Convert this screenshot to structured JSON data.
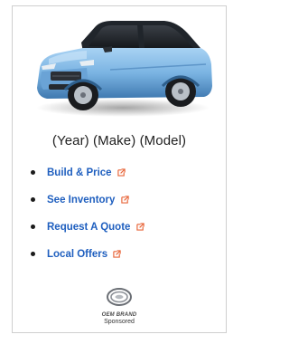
{
  "ad": {
    "title": "(Year) (Make) (Model)",
    "links": [
      {
        "label": "Build & Price"
      },
      {
        "label": "See Inventory"
      },
      {
        "label": "Request A Quote"
      },
      {
        "label": "Local Offers"
      }
    ],
    "brand_name": "OEM BRAND",
    "sponsored_label": "Sponsored"
  },
  "colors": {
    "link": "#1f5fbf",
    "title": "#222222",
    "car_body": "#7fb4e3",
    "card_border": "#cfcfcf"
  },
  "icons": {
    "link_icon": "external-link-icon",
    "brand_logo": "oem-brand-logo"
  }
}
